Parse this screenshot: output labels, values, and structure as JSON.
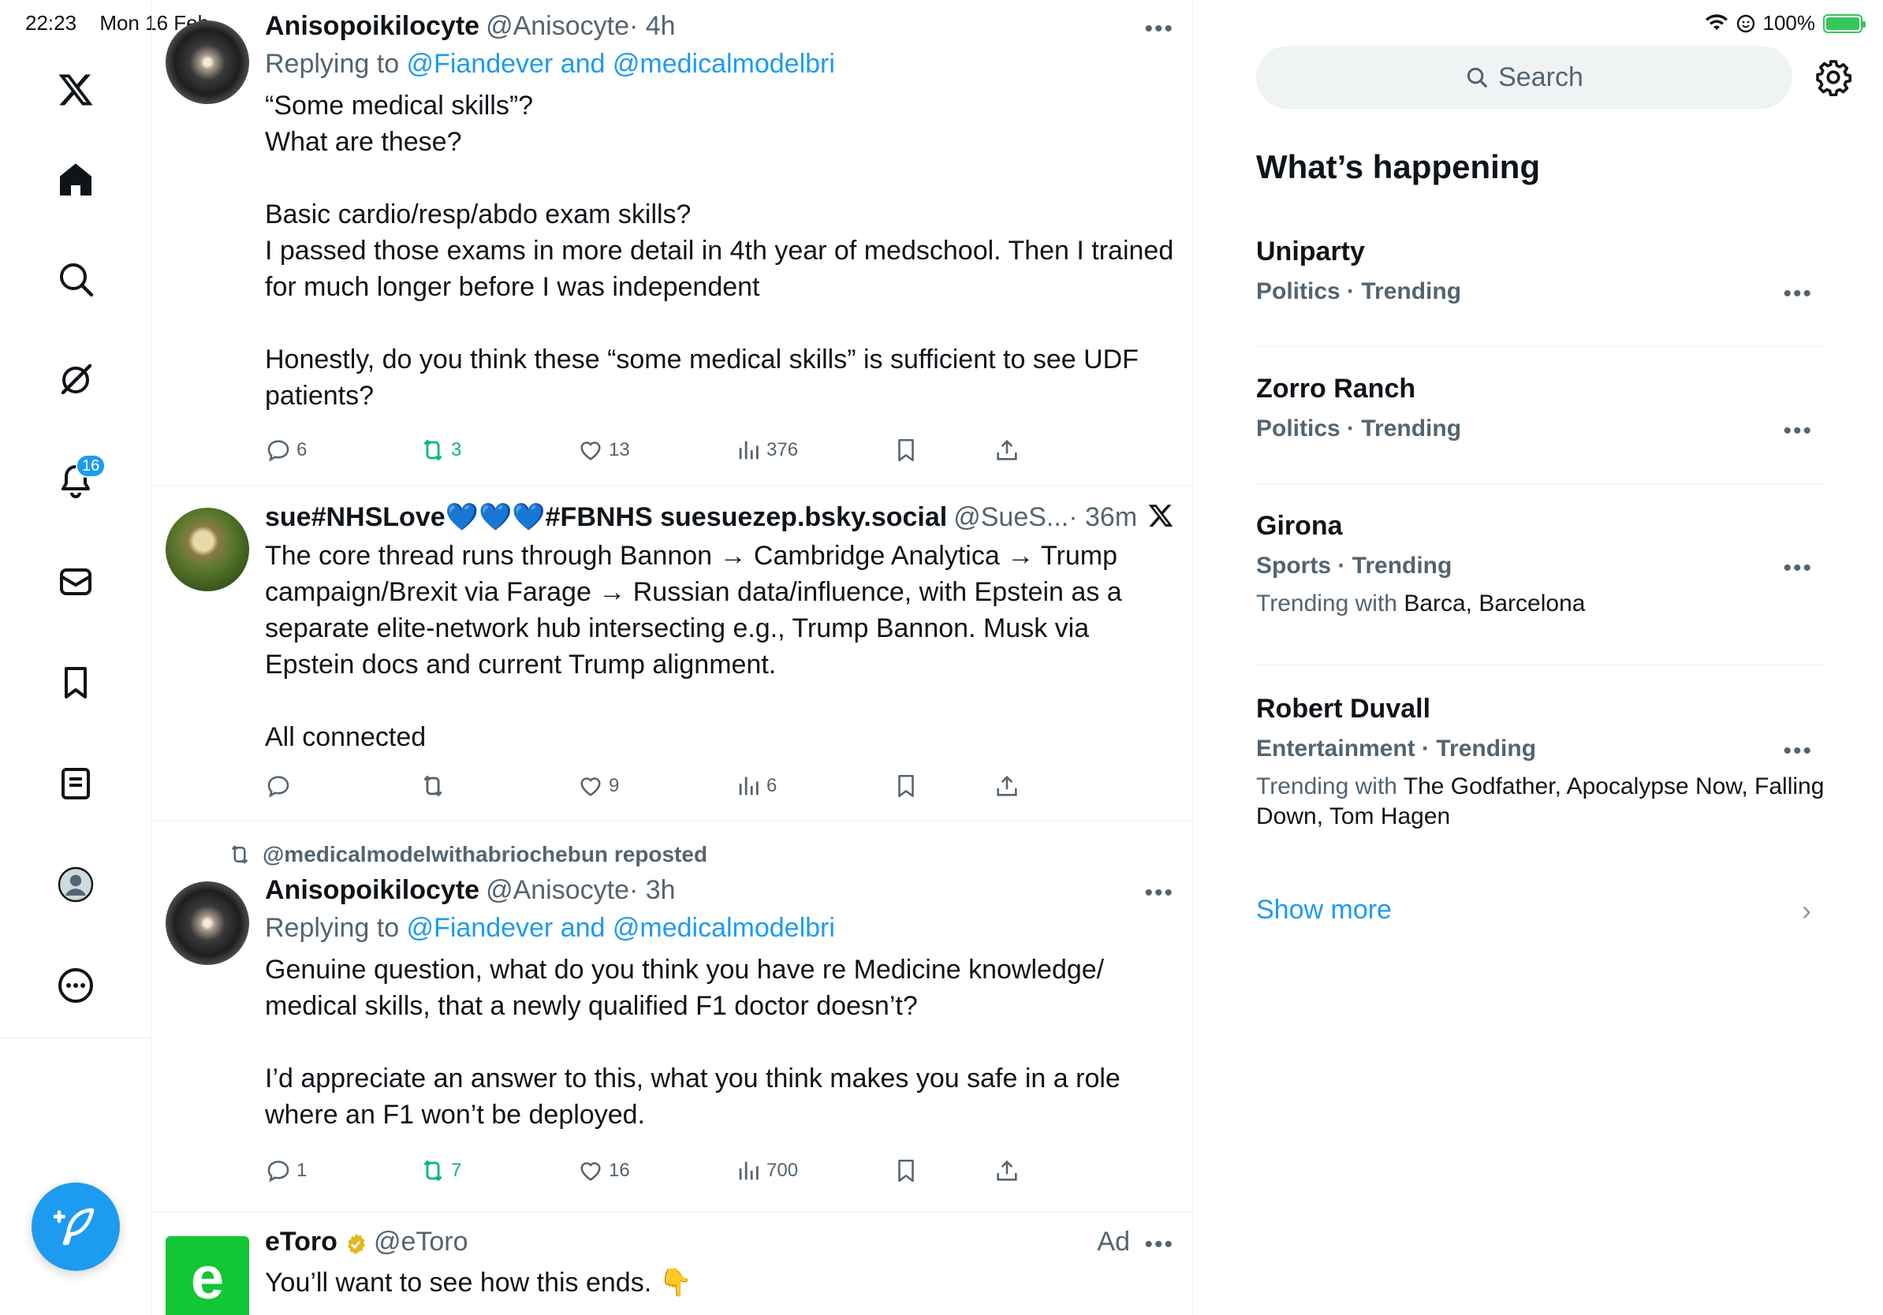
{
  "status_bar": {
    "time": "22:23",
    "date": "Mon 16 Feb",
    "battery": "100%"
  },
  "nav": {
    "notifications_badge": "16"
  },
  "tweets": [
    {
      "name": "Anisopoikilocyte",
      "handle": "@Anisocyte",
      "time": "· 4h",
      "replying_prefix": "Replying to ",
      "replying_to": "@Fiandever and @medicalmodelbri",
      "text": "“Some medical skills”?\nWhat are these?\n\nBasic cardio/resp/abdo exam skills?\nI passed those exams in more detail in 4th year of medschool. Then I trained for much longer before I was independent\n\nHonestly, do you think these “some medical skills” is sufficient to see UDF patients?",
      "replies": "6",
      "reposts": "3",
      "likes": "13",
      "views": "376"
    },
    {
      "name": "sue#NHSLove💙💙💙#FBNHS suesuezep.bsky.social",
      "handle": "@SueS...",
      "time": "· 36m",
      "text": "The core thread runs through Bannon → Cambridge Analytica → Trump campaign/Brexit via Farage → Russian data/influence, with Epstein as a separate elite-network hub intersecting e.g., Trump Bannon. Musk via Epstein docs and current Trump alignment.\n\nAll connected",
      "replies": "",
      "reposts": "",
      "likes": "9",
      "views": "6"
    },
    {
      "repost_by": "@medicalmodelwithabriochebun reposted",
      "name": "Anisopoikilocyte",
      "handle": "@Anisocyte",
      "time": "· 3h",
      "replying_prefix": "Replying to ",
      "replying_to": "@Fiandever and @medicalmodelbri",
      "text": "Genuine question, what do you think you have re Medicine knowledge/ medical skills, that a newly qualified F1 doctor doesn’t?\n\nI’d appreciate an answer to this, what you think makes you safe in a role where an F1 won’t be deployed.",
      "replies": "1",
      "reposts": "7",
      "likes": "16",
      "views": "700"
    },
    {
      "name": "eToro",
      "handle": "@eToro",
      "ad": "Ad",
      "text": "You’ll want to see how this ends. 👇",
      "avatar_letter": "e"
    }
  ],
  "sidebar": {
    "search_placeholder": "Search",
    "title": "What’s happening",
    "trends": [
      {
        "title": "Uniparty",
        "meta": "Politics · Trending"
      },
      {
        "title": "Zorro Ranch",
        "meta": "Politics · Trending"
      },
      {
        "title": "Girona",
        "meta": "Sports · Trending",
        "with_label": "Trending with ",
        "with": "Barca, Barcelona"
      },
      {
        "title": "Robert Duvall",
        "meta": "Entertainment · Trending",
        "with_label": "Trending with ",
        "with": "The Godfather, Apocalypse Now, Falling Down, Tom Hagen"
      }
    ],
    "show_more": "Show more"
  },
  "colors": {
    "accent": "#1d9bf0",
    "repost_green": "#00ba7c",
    "secondary_text": "#536471"
  }
}
